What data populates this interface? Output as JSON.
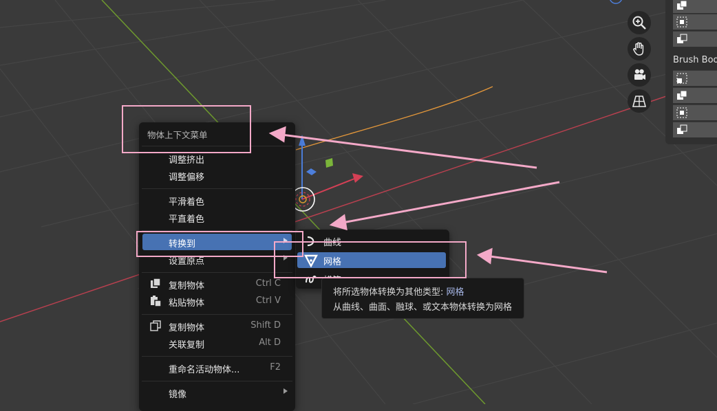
{
  "colors": {
    "viewport_bg": "#3a3a3a",
    "grid": "#434343",
    "axis_y_green": "#6e9a2e",
    "axis_x_red": "#b8404f",
    "curve_orange": "#e2963a",
    "menu_bg": "#181818",
    "highlight_blue": "#4772b3",
    "annotation_pink": "#f4a9c8"
  },
  "navigation": {
    "icons": [
      "zoom-icon",
      "pan-hand-icon",
      "camera-icon",
      "perspective-grid-icon"
    ]
  },
  "side_panel": {
    "label": "Brush Boo"
  },
  "context_menu": {
    "title": "物体上下文菜单",
    "items": [
      {
        "label": "调整挤出",
        "shortcut": ""
      },
      {
        "label": "调整偏移",
        "shortcut": ""
      },
      {
        "label": "平滑着色",
        "shortcut": ""
      },
      {
        "label": "平直着色",
        "shortcut": ""
      },
      {
        "label": "转换到",
        "shortcut": ""
      },
      {
        "label": "设置原点",
        "shortcut": ""
      },
      {
        "label": "复制物体",
        "shortcut": "Ctrl C"
      },
      {
        "label": "粘贴物体",
        "shortcut": "Ctrl V"
      },
      {
        "label": "复制物体",
        "shortcut": "Shift D"
      },
      {
        "label": "关联复制",
        "shortcut": "Alt D"
      },
      {
        "label": "重命名活动物体...",
        "shortcut": "F2"
      },
      {
        "label": "镜像",
        "shortcut": ""
      }
    ]
  },
  "submenu": {
    "items": [
      {
        "label": "曲线"
      },
      {
        "label": "网格"
      },
      {
        "label": "蜡笔"
      }
    ]
  },
  "tooltip": {
    "line1_prefix": "将所选物体转换为其他类型:",
    "line1_value": "网格",
    "line2": "从曲线、曲面、融球、或文本物体转换为网格"
  }
}
